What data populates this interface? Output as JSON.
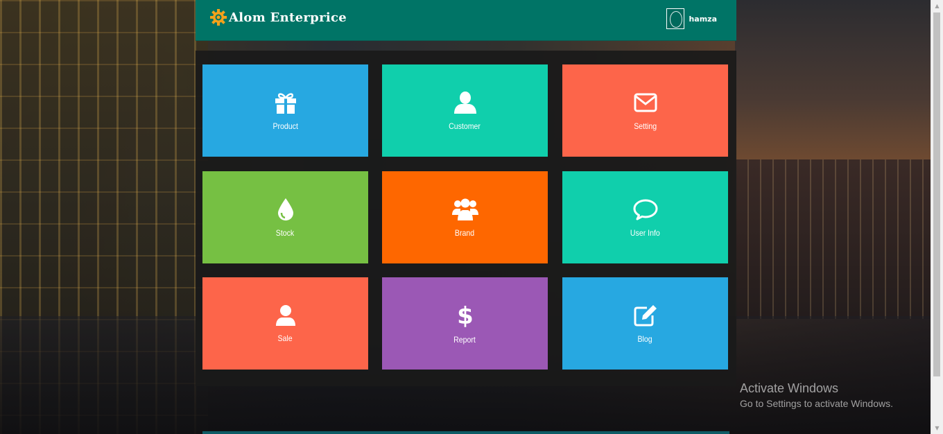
{
  "header": {
    "brand_title": "Alom Enterprice",
    "user_name": "hamza"
  },
  "tiles": [
    {
      "label": "Product",
      "icon": "gift-icon",
      "color": "#27a8e1"
    },
    {
      "label": "Customer",
      "icon": "user-icon",
      "color": "#10cfac"
    },
    {
      "label": "Setting",
      "icon": "envelope-icon",
      "color": "#fd654a"
    },
    {
      "label": "Stock",
      "icon": "droplet-icon",
      "color": "#76c043"
    },
    {
      "label": "Brand",
      "icon": "users-icon",
      "color": "#fe6700"
    },
    {
      "label": "User Info",
      "icon": "comment-icon",
      "color": "#10cfac"
    },
    {
      "label": "Sale",
      "icon": "user-icon",
      "color": "#fd654a"
    },
    {
      "label": "Report",
      "icon": "dollar-icon",
      "color": "#9b58b5"
    },
    {
      "label": "Blog",
      "icon": "edit-icon",
      "color": "#27a8e1"
    }
  ],
  "watermark": {
    "title": "Activate Windows",
    "subtitle": "Go to Settings to activate Windows."
  },
  "colors": {
    "header_bg": "#007466",
    "panel_bg": "#1a1a1a"
  }
}
